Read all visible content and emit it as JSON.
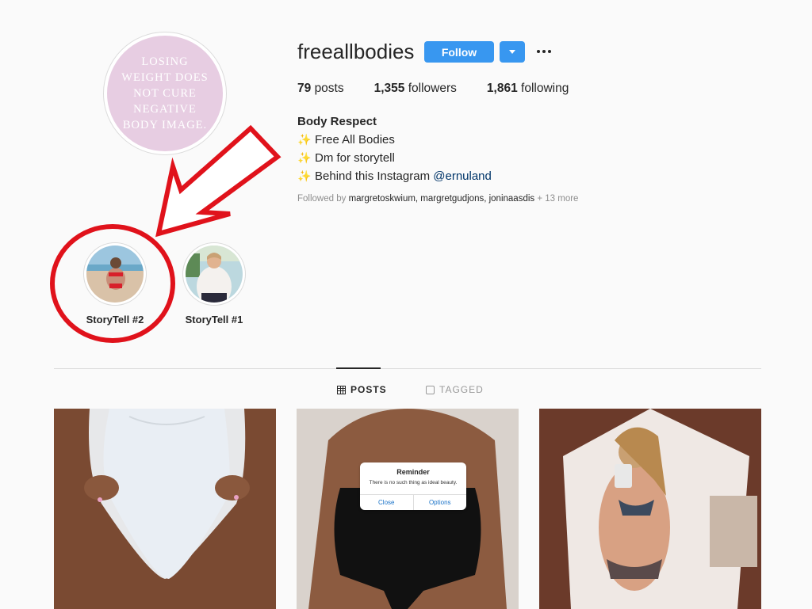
{
  "profile": {
    "avatar_text": "LOSING WEIGHT DOES NOT CURE NEGATIVE BODY IMAGE.",
    "username": "freeallbodies",
    "follow_label": "Follow",
    "stats": {
      "posts_count": "79",
      "posts_label": "posts",
      "followers_count": "1,355",
      "followers_label": "followers",
      "following_count": "1,861",
      "following_label": "following"
    },
    "bio": {
      "title": "Body Respect",
      "line1": "Free All Bodies",
      "line2": "Dm for storytell",
      "line3_prefix": "Behind this Instagram ",
      "line3_mention": "@ernuland"
    },
    "followed_by": {
      "prefix": "Followed by ",
      "names": "margretoskwium, margretgudjons, joninaasdis",
      "suffix": " + 13 more"
    }
  },
  "highlights": [
    {
      "label": "StoryTell #2"
    },
    {
      "label": "StoryTell #1"
    }
  ],
  "tabs": {
    "posts": "POSTS",
    "tagged": "TAGGED"
  },
  "posts": {
    "reminder": {
      "title": "Reminder",
      "text": "There is no such thing as ideal beauty.",
      "close": "Close",
      "options": "Options"
    }
  },
  "colors": {
    "accent": "#3897f0",
    "annotation_red": "#e0121b"
  }
}
